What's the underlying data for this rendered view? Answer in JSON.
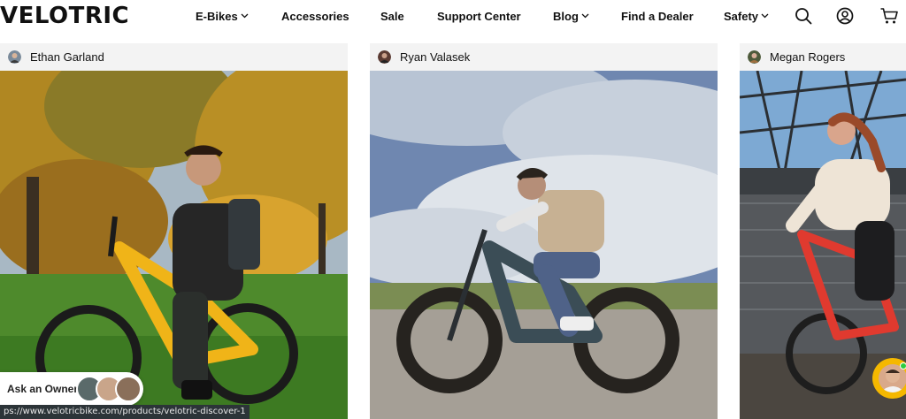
{
  "header": {
    "logo": "VELOTRIC",
    "nav": [
      {
        "label": "E-Bikes",
        "dropdown": true
      },
      {
        "label": "Accessories",
        "dropdown": false
      },
      {
        "label": "Sale",
        "dropdown": false
      },
      {
        "label": "Support Center",
        "dropdown": false
      },
      {
        "label": "Blog",
        "dropdown": true
      },
      {
        "label": "Find a Dealer",
        "dropdown": false
      },
      {
        "label": "Safety",
        "dropdown": true
      }
    ],
    "icons": [
      "search-icon",
      "account-icon",
      "cart-icon"
    ]
  },
  "cards": [
    {
      "author": "Ethan Garland",
      "photo": "rider with backpack on yellow e-bike in autumn park"
    },
    {
      "author": "Ryan Valasek",
      "photo": "rider on dark teal fat-tire e-bike with motion blur"
    },
    {
      "author": "Megan Rogers",
      "photo": "woman on red e-bike on bridge"
    }
  ],
  "ask_owner": {
    "label": "Ask an Owner"
  },
  "status_url": "ps://www.velotricbike.com/products/velotric-discover-1",
  "colors": {
    "brand_text": "#111111",
    "chat_ring": "#f5b800",
    "online_dot": "#2ecc40"
  }
}
